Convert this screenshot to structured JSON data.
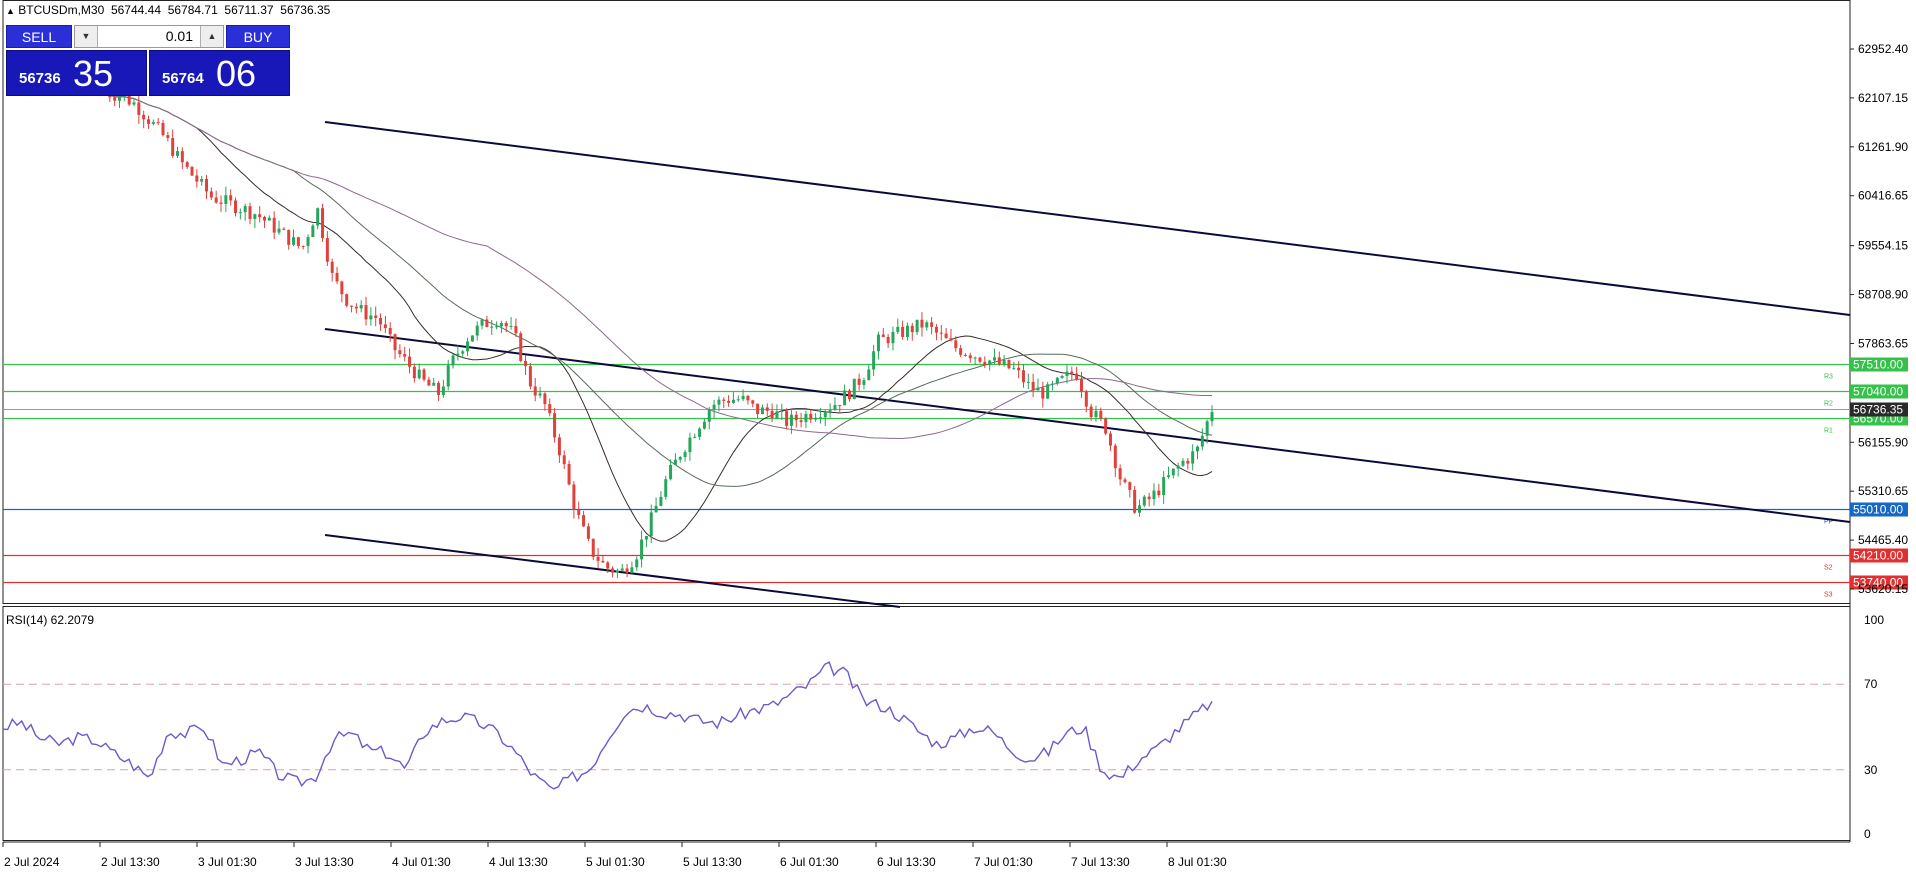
{
  "chart_info": {
    "symbol_timeframe": "BTCUSDm,M30",
    "ohlc": [
      "56744.44",
      "56784.71",
      "56711.37",
      "56736.35"
    ]
  },
  "trade_panel": {
    "sell_label": "SELL",
    "buy_label": "BUY",
    "lot": "0.01",
    "sell_price_small": "56736",
    "sell_price_big": "35",
    "buy_price_small": "56764",
    "buy_price_big": "06"
  },
  "price_axis": {
    "ticks": [
      "62952.40",
      "62107.15",
      "61261.90",
      "60416.65",
      "59554.15",
      "58708.90",
      "57863.65",
      "56155.90",
      "55310.65",
      "54465.40",
      "53620.15"
    ]
  },
  "levels": [
    {
      "price": 57510.0,
      "label": "57510.00",
      "color": "#35c24a",
      "tag": "R3"
    },
    {
      "price": 57040.0,
      "label": "57040.00",
      "color": "#35c24a",
      "tag": "R2"
    },
    {
      "price": 56570.0,
      "label": "56570.00",
      "color": "#35c24a",
      "tag": "R1"
    },
    {
      "price": 55010.0,
      "label": "55010.00",
      "color": "#1668c7",
      "tag": "PP"
    },
    {
      "price": 54210.0,
      "label": "54210.00",
      "color": "#e03030",
      "tag": "S2"
    },
    {
      "price": 53740.0,
      "label": "53740.00",
      "color": "#e03030",
      "tag": "S3"
    }
  ],
  "current_price": {
    "price": 56736.35,
    "label": "56736.35"
  },
  "rsi": {
    "label": "RSI(14) 62.2079",
    "axis_ticks": [
      "100",
      "70",
      "30",
      "0"
    ],
    "levels": [
      70,
      30
    ]
  },
  "time_axis": {
    "ticks": [
      "2 Jul 2024",
      "2 Jul 13:30",
      "3 Jul 01:30",
      "3 Jul 13:30",
      "4 Jul 01:30",
      "4 Jul 13:30",
      "5 Jul 01:30",
      "5 Jul 13:30",
      "6 Jul 01:30",
      "6 Jul 13:30",
      "7 Jul 01:30",
      "7 Jul 13:30",
      "8 Jul 01:30"
    ]
  },
  "colors": {
    "bull": "#26a65b",
    "bear": "#e0413a",
    "trendline": "#0a0a3a",
    "rsi_line": "#6a5acd",
    "ma_fast": "#3a2a2a",
    "ma_mid": "#5a6a5a",
    "ma_slow": "#8a6a8a"
  },
  "chart_data": {
    "type": "candlestick",
    "series": [
      {
        "name": "BTCUSDm,M30",
        "close_path": [
          62200,
          62150,
          62000,
          61700,
          61400,
          61000,
          60700,
          60400,
          60300,
          60200,
          60100,
          59900,
          59700,
          59500,
          60200,
          59000,
          58600,
          58400,
          58300,
          57800,
          57500,
          57200,
          57000,
          57600,
          58000,
          58200,
          58300,
          58000,
          57200,
          56800,
          56000,
          55000,
          54300,
          54000,
          53900,
          54200,
          54800,
          55500,
          56000,
          56400,
          56800,
          56900,
          56900,
          56700,
          56700,
          56500,
          56600,
          56700,
          56800,
          57000,
          57300,
          57900,
          58000,
          58100,
          58200,
          58000,
          57800,
          57700,
          57600,
          57500,
          57400,
          57100,
          57000,
          57200,
          57400,
          56700,
          56400,
          55500,
          55000,
          55200,
          55500,
          55800,
          56000,
          56736
        ]
      }
    ],
    "rsi_path": [
      50,
      52,
      45,
      42,
      45,
      44,
      38,
      33,
      26,
      48,
      47,
      50,
      32,
      35,
      38,
      28,
      24,
      26,
      44,
      47,
      39,
      38,
      30,
      48,
      53,
      55,
      52,
      47,
      38,
      27,
      20,
      26,
      30,
      45,
      58,
      60,
      57,
      56,
      53,
      52,
      55,
      58,
      60,
      65,
      70,
      78,
      75,
      62,
      60,
      55,
      48,
      42,
      45,
      50,
      48,
      40,
      35,
      38,
      47,
      50,
      30,
      26,
      35,
      40,
      48,
      55,
      62
    ]
  }
}
